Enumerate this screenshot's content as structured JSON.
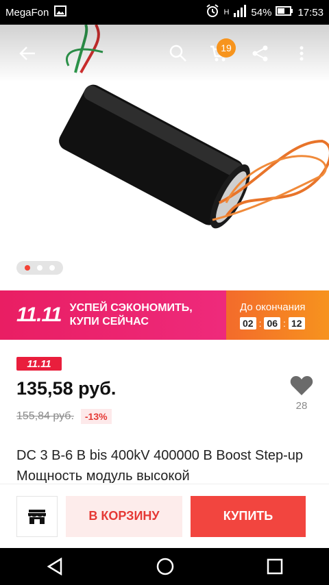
{
  "status_bar": {
    "carrier": "MegaFon",
    "network": "H",
    "battery": "54%",
    "time": "17:53"
  },
  "top_bar": {
    "cart_count": "19"
  },
  "gallery": {
    "image_count": 3,
    "active_index": 0
  },
  "promo": {
    "logo": "11.11",
    "text_line1": "УСПЕЙ СЭКОНОМИТЬ,",
    "text_line2": "КУПИ СЕЙЧАС",
    "countdown_label": "До окончания",
    "timer": {
      "hours": "02",
      "minutes": "06",
      "seconds": "12"
    }
  },
  "product": {
    "sale_badge": "11.11",
    "price": "135,58 руб.",
    "old_price": "155,84 руб.",
    "discount": "-13%",
    "favorites_count": "28",
    "title": "DC 3 В-6 В bis 400kV 400000 В Boost Step-up Мощность модуль высокой"
  },
  "actions": {
    "cart_label": "В КОРЗИНУ",
    "buy_label": "КУПИТЬ"
  },
  "colors": {
    "accent_red": "#f2453f",
    "promo_pink": "#e91e63",
    "promo_orange": "#f7931e",
    "badge_orange": "#f7941d"
  }
}
